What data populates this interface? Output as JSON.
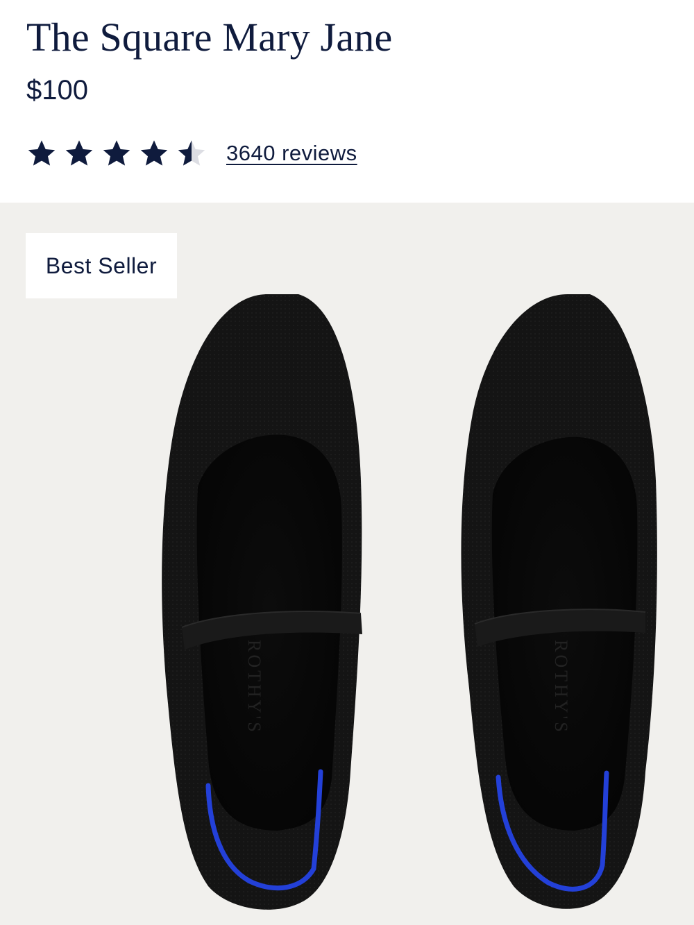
{
  "product": {
    "title": "The Square Mary Jane",
    "price": "$100",
    "rating": 4.5,
    "rating_max": 5,
    "reviews_label": "3640 reviews"
  },
  "media": {
    "badge": "Best Seller",
    "insole_brand": "ROTHY'S",
    "image_name": "black-square-mary-jane-shoes"
  },
  "colors": {
    "navy": "#0f1b3d",
    "background": "#f1f0ed",
    "shoe": "#121212",
    "accent_blue": "#2340d8",
    "star_empty": "#dcdde3"
  }
}
